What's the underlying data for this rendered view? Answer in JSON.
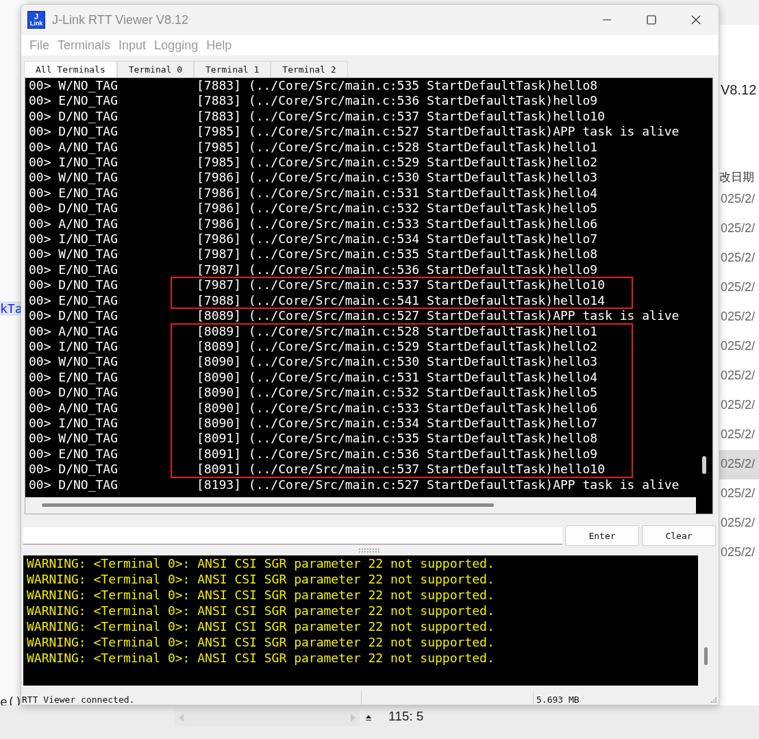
{
  "background": {
    "left_texts": [
      {
        "text": "kTa",
        "kind": "code"
      },
      {
        "text": "e()",
        "kind": "plain"
      }
    ],
    "right_header": "V8.12",
    "right_column_title": "改日期",
    "right_dates": [
      {
        "text": "025/2/",
        "selected": false
      },
      {
        "text": "025/2/",
        "selected": false
      },
      {
        "text": "025/2/",
        "selected": false
      },
      {
        "text": "025/2/",
        "selected": false
      },
      {
        "text": "025/2/",
        "selected": false
      },
      {
        "text": "025/2/",
        "selected": false
      },
      {
        "text": "025/2/",
        "selected": false
      },
      {
        "text": "025/2/",
        "selected": false
      },
      {
        "text": "025/2/",
        "selected": false
      },
      {
        "text": "025/2/",
        "selected": true
      },
      {
        "text": "025/2/",
        "selected": false
      },
      {
        "text": "025/2/",
        "selected": false
      },
      {
        "text": "025/2/",
        "selected": false
      }
    ],
    "cursor_position": "115: 5"
  },
  "window": {
    "logo": [
      "J",
      "Link"
    ],
    "title": "J-Link RTT Viewer V8.12"
  },
  "menu": [
    "File",
    "Terminals",
    "Input",
    "Logging",
    "Help"
  ],
  "tabs": [
    {
      "label": "All Terminals",
      "selected": true
    },
    {
      "label": "Terminal 0",
      "selected": false
    },
    {
      "label": "Terminal 1",
      "selected": false
    },
    {
      "label": "Terminal 2",
      "selected": false
    }
  ],
  "log_blocks": [
    {
      "boxed": false,
      "lines": [
        {
          "prefix": "00> W/NO_TAG",
          "message": "[7883] (../Core/Src/main.c:535 StartDefaultTask)hello8"
        },
        {
          "prefix": "00> E/NO_TAG",
          "message": "[7883] (../Core/Src/main.c:536 StartDefaultTask)hello9"
        },
        {
          "prefix": "00> D/NO_TAG",
          "message": "[7883] (../Core/Src/main.c:537 StartDefaultTask)hello10"
        },
        {
          "prefix": "00> D/NO_TAG",
          "message": "[7985] (../Core/Src/main.c:527 StartDefaultTask)APP task is alive"
        },
        {
          "prefix": "00> A/NO_TAG",
          "message": "[7985] (../Core/Src/main.c:528 StartDefaultTask)hello1"
        },
        {
          "prefix": "00> I/NO_TAG",
          "message": "[7985] (../Core/Src/main.c:529 StartDefaultTask)hello2"
        },
        {
          "prefix": "00> W/NO_TAG",
          "message": "[7986] (../Core/Src/main.c:530 StartDefaultTask)hello3"
        },
        {
          "prefix": "00> E/NO_TAG",
          "message": "[7986] (../Core/Src/main.c:531 StartDefaultTask)hello4"
        },
        {
          "prefix": "00> D/NO_TAG",
          "message": "[7986] (../Core/Src/main.c:532 StartDefaultTask)hello5"
        },
        {
          "prefix": "00> A/NO_TAG",
          "message": "[7986] (../Core/Src/main.c:533 StartDefaultTask)hello6"
        },
        {
          "prefix": "00> I/NO_TAG",
          "message": "[7986] (../Core/Src/main.c:534 StartDefaultTask)hello7"
        },
        {
          "prefix": "00> W/NO_TAG",
          "message": "[7987] (../Core/Src/main.c:535 StartDefaultTask)hello8"
        },
        {
          "prefix": "00> E/NO_TAG",
          "message": "[7987] (../Core/Src/main.c:536 StartDefaultTask)hello9"
        }
      ]
    },
    {
      "boxed": true,
      "lines": [
        {
          "prefix": "00> D/NO_TAG",
          "message": "[7987] (../Core/Src/main.c:537 StartDefaultTask)hello10"
        },
        {
          "prefix": "00> E/NO_TAG",
          "message": "[7988] (../Core/Src/main.c:541 StartDefaultTask)hello14"
        }
      ]
    },
    {
      "boxed": false,
      "lines": [
        {
          "prefix": "00> D/NO_TAG",
          "message": "[8089] (../Core/Src/main.c:527 StartDefaultTask)APP task is alive"
        }
      ]
    },
    {
      "boxed": true,
      "lines": [
        {
          "prefix": "00> A/NO_TAG",
          "message": "[8089] (../Core/Src/main.c:528 StartDefaultTask)hello1"
        },
        {
          "prefix": "00> I/NO_TAG",
          "message": "[8089] (../Core/Src/main.c:529 StartDefaultTask)hello2"
        },
        {
          "prefix": "00> W/NO_TAG",
          "message": "[8090] (../Core/Src/main.c:530 StartDefaultTask)hello3"
        },
        {
          "prefix": "00> E/NO_TAG",
          "message": "[8090] (../Core/Src/main.c:531 StartDefaultTask)hello4"
        },
        {
          "prefix": "00> D/NO_TAG",
          "message": "[8090] (../Core/Src/main.c:532 StartDefaultTask)hello5"
        },
        {
          "prefix": "00> A/NO_TAG",
          "message": "[8090] (../Core/Src/main.c:533 StartDefaultTask)hello6"
        },
        {
          "prefix": "00> I/NO_TAG",
          "message": "[8090] (../Core/Src/main.c:534 StartDefaultTask)hello7"
        },
        {
          "prefix": "00> W/NO_TAG",
          "message": "[8091] (../Core/Src/main.c:535 StartDefaultTask)hello8"
        },
        {
          "prefix": "00> E/NO_TAG",
          "message": "[8091] (../Core/Src/main.c:536 StartDefaultTask)hello9"
        },
        {
          "prefix": "00> D/NO_TAG",
          "message": "[8091] (../Core/Src/main.c:537 StartDefaultTask)hello10"
        }
      ]
    },
    {
      "boxed": false,
      "lines": [
        {
          "prefix": "00> D/NO_TAG",
          "message": "[8193] (../Core/Src/main.c:527 StartDefaultTask)APP task is alive"
        }
      ]
    }
  ],
  "input": {
    "buttons": [
      "Enter",
      "Clear"
    ]
  },
  "warnings": [
    "WARNING: <Terminal 0>: ANSI CSI SGR parameter 22 not supported.",
    "WARNING: <Terminal 0>: ANSI CSI SGR parameter 22 not supported.",
    "WARNING: <Terminal 0>: ANSI CSI SGR parameter 22 not supported.",
    "WARNING: <Terminal 0>: ANSI CSI SGR parameter 22 not supported.",
    "WARNING: <Terminal 0>: ANSI CSI SGR parameter 22 not supported.",
    "WARNING: <Terminal 0>: ANSI CSI SGR parameter 22 not supported.",
    "WARNING: <Terminal 0>: ANSI CSI SGR parameter 22 not supported."
  ],
  "status_bar": {
    "message": "RTT Viewer connected.",
    "memory": "5.693 MB"
  }
}
